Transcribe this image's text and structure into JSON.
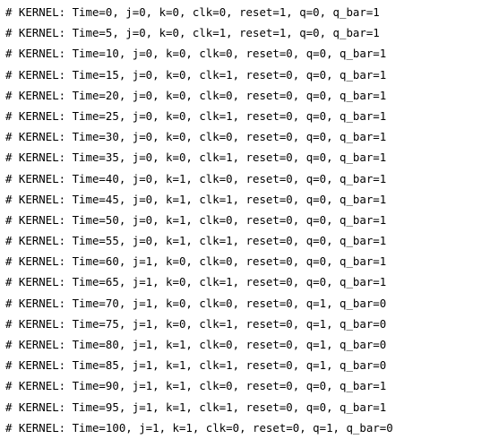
{
  "console": {
    "lines": [
      "# KERNEL: Time=0, j=0, k=0, clk=0, reset=1, q=0, q_bar=1",
      "# KERNEL: Time=5, j=0, k=0, clk=1, reset=1, q=0, q_bar=1",
      "# KERNEL: Time=10, j=0, k=0, clk=0, reset=0, q=0, q_bar=1",
      "# KERNEL: Time=15, j=0, k=0, clk=1, reset=0, q=0, q_bar=1",
      "# KERNEL: Time=20, j=0, k=0, clk=0, reset=0, q=0, q_bar=1",
      "# KERNEL: Time=25, j=0, k=0, clk=1, reset=0, q=0, q_bar=1",
      "# KERNEL: Time=30, j=0, k=0, clk=0, reset=0, q=0, q_bar=1",
      "# KERNEL: Time=35, j=0, k=0, clk=1, reset=0, q=0, q_bar=1",
      "# KERNEL: Time=40, j=0, k=1, clk=0, reset=0, q=0, q_bar=1",
      "# KERNEL: Time=45, j=0, k=1, clk=1, reset=0, q=0, q_bar=1",
      "# KERNEL: Time=50, j=0, k=1, clk=0, reset=0, q=0, q_bar=1",
      "# KERNEL: Time=55, j=0, k=1, clk=1, reset=0, q=0, q_bar=1",
      "# KERNEL: Time=60, j=1, k=0, clk=0, reset=0, q=0, q_bar=1",
      "# KERNEL: Time=65, j=1, k=0, clk=1, reset=0, q=0, q_bar=1",
      "# KERNEL: Time=70, j=1, k=0, clk=0, reset=0, q=1, q_bar=0",
      "# KERNEL: Time=75, j=1, k=0, clk=1, reset=0, q=1, q_bar=0",
      "# KERNEL: Time=80, j=1, k=1, clk=0, reset=0, q=1, q_bar=0",
      "# KERNEL: Time=85, j=1, k=1, clk=1, reset=0, q=1, q_bar=0",
      "# KERNEL: Time=90, j=1, k=1, clk=0, reset=0, q=0, q_bar=1",
      "# KERNEL: Time=95, j=1, k=1, clk=1, reset=0, q=0, q_bar=1",
      "# KERNEL: Time=100, j=1, k=1, clk=0, reset=0, q=1, q_bar=0"
    ]
  }
}
